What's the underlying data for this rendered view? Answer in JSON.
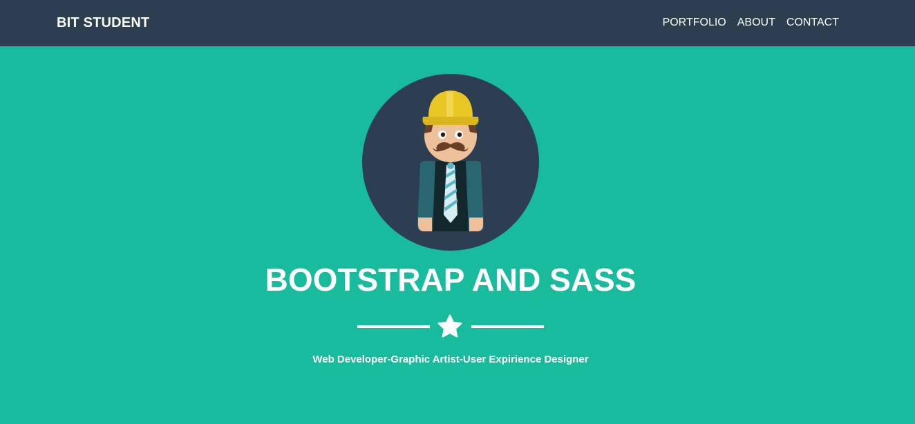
{
  "navbar": {
    "brand": "BIT STUDENT",
    "links": [
      "PORTFOLIO",
      "ABOUT",
      "CONTACT"
    ]
  },
  "hero": {
    "title": "BOOTSTRAP AND SASS",
    "subtitle": "Web Developer-Graphic Artist-User Expirience Designer",
    "avatar_icon": "construction-worker-avatar-icon",
    "divider_icon": "star-icon"
  },
  "colors": {
    "navbar_bg": "#2c3e50",
    "hero_bg": "#18bc9c",
    "text": "#ffffff",
    "avatar_circle": "#2c3e50",
    "hard_hat": "#e8c624"
  }
}
